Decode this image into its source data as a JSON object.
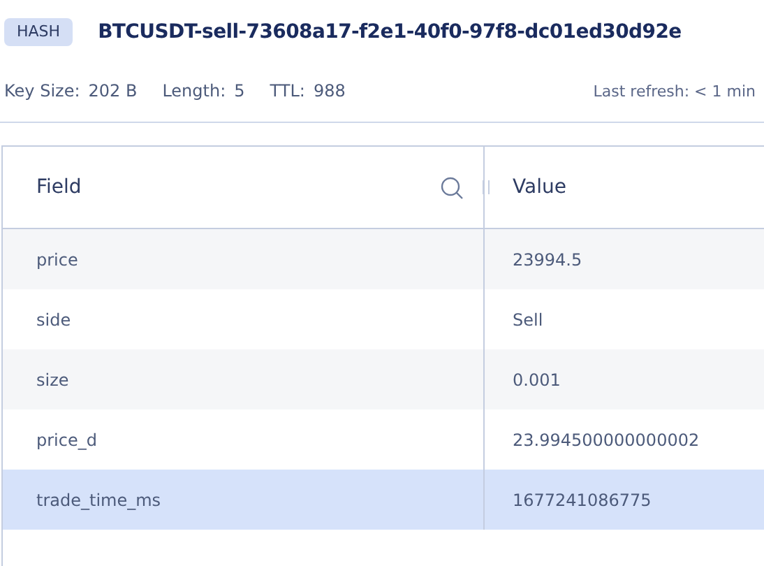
{
  "header": {
    "type_badge": "HASH",
    "key_name": "BTCUSDT-sell-73608a17-f2e1-40f0-97f8-dc01ed30d92e"
  },
  "meta": [
    {
      "label": "Key Size:",
      "value": "202 B"
    },
    {
      "label": "Length:",
      "value": "5"
    },
    {
      "label": "TTL:",
      "value": "988"
    }
  ],
  "last_refresh": "Last refresh: < 1 min",
  "table": {
    "columns": [
      "Field",
      "Value"
    ],
    "rows": [
      {
        "field": "price",
        "value": "23994.5",
        "selected": false
      },
      {
        "field": "side",
        "value": "Sell",
        "selected": false
      },
      {
        "field": "size",
        "value": "0.001",
        "selected": false
      },
      {
        "field": "price_d",
        "value": "23.994500000000002",
        "selected": false
      },
      {
        "field": "trade_time_ms",
        "value": "1677241086775",
        "selected": true
      }
    ]
  }
}
